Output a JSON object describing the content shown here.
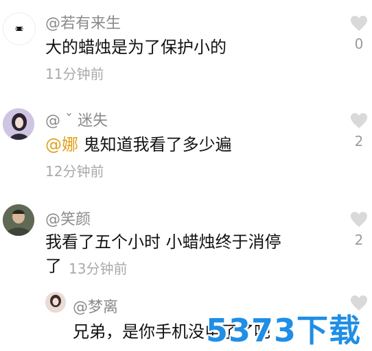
{
  "comments": [
    {
      "name": "@若有来生",
      "text": "大的蜡烛是为了保护小的",
      "time": "11分钟前",
      "likes": "0"
    },
    {
      "name": "@ ˇ  迷失",
      "mention": "@娜",
      "text": " 鬼知道我看了多少遍",
      "time": "12分钟前",
      "likes": "2"
    },
    {
      "name": "@笑颜",
      "text_line1": "我看了五个小时 小蜡烛终于消停",
      "text_line2": "了",
      "time": "13分钟前",
      "likes": "2"
    }
  ],
  "reply": {
    "name": "@梦离",
    "text": "兄弟，是你手机没电了了吧"
  },
  "watermark": "5373下载",
  "colors": {
    "name": "#8a8a8a",
    "mention": "#e0a11b",
    "time": "#a9a9a9",
    "watermark": "#1f8ee6"
  }
}
